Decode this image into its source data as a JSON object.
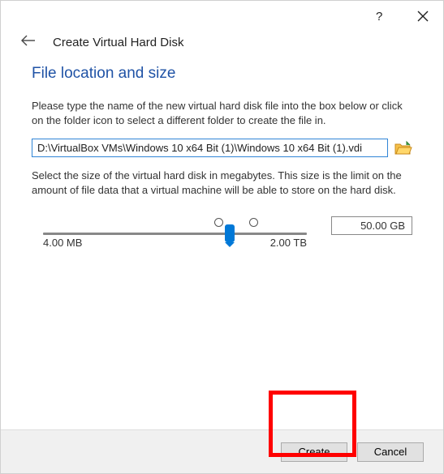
{
  "titlebar": {
    "help_tooltip": "?",
    "close_tooltip": "Close"
  },
  "header": {
    "back_label": "Back",
    "wizard_title": "Create Virtual Hard Disk"
  },
  "section": {
    "heading": "File location and size",
    "desc1": "Please type the name of the new virtual hard disk file into the box below or click on the folder icon to select a different folder to create the file in.",
    "path_value": "D:\\VirtualBox VMs\\Windows 10 x64 Bit (1)\\Windows 10 x64 Bit (1).vdi",
    "folder_tooltip": "Choose folder",
    "desc2": "Select the size of the virtual hard disk in megabytes. This size is the limit on the amount of file data that a virtual machine will be able to store on the hard disk.",
    "size_value": "50.00 GB",
    "min_label": "4.00 MB",
    "max_label": "2.00 TB"
  },
  "buttons": {
    "create": "Create",
    "cancel": "Cancel"
  }
}
